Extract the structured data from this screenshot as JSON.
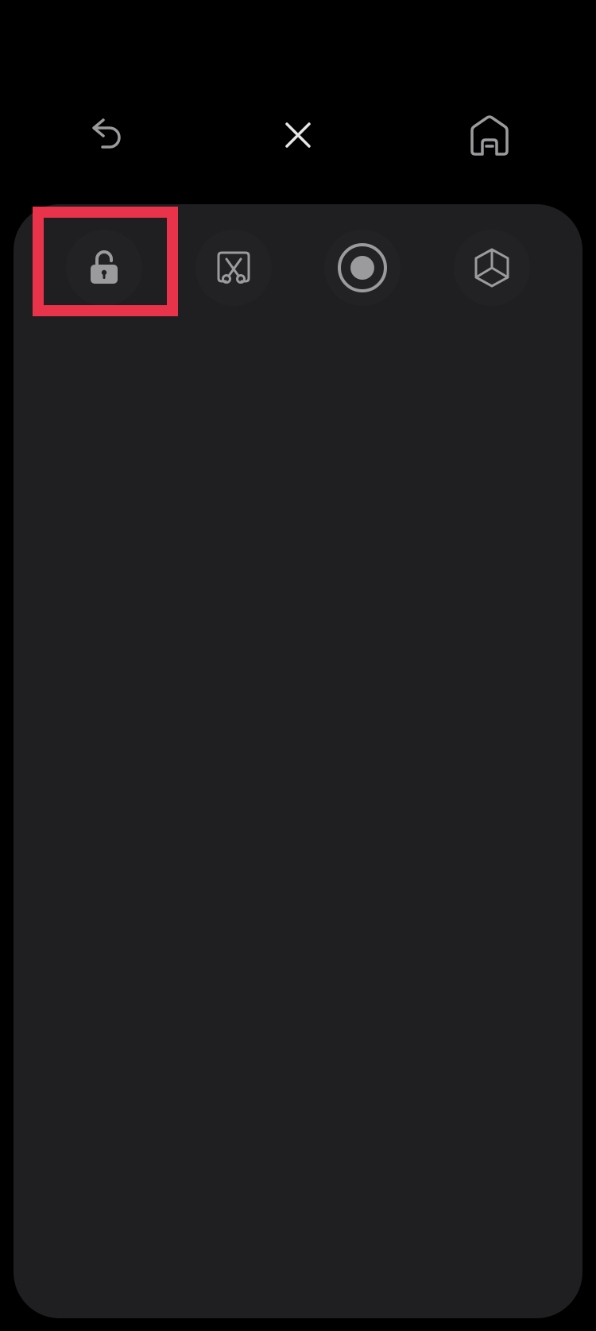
{
  "colors": {
    "background": "#000000",
    "panel": "#1f1f21",
    "icon": "#9b9b9e",
    "highlight": "#e8334a"
  },
  "top_bar": {
    "buttons": [
      {
        "icon": "undo-arrow-icon"
      },
      {
        "icon": "close-icon"
      },
      {
        "icon": "home-icon"
      }
    ]
  },
  "toolbar": {
    "tools": [
      {
        "icon": "unlock-icon",
        "highlighted": true
      },
      {
        "icon": "scissors-frame-icon"
      },
      {
        "icon": "record-icon"
      },
      {
        "icon": "cube-icon"
      }
    ]
  }
}
